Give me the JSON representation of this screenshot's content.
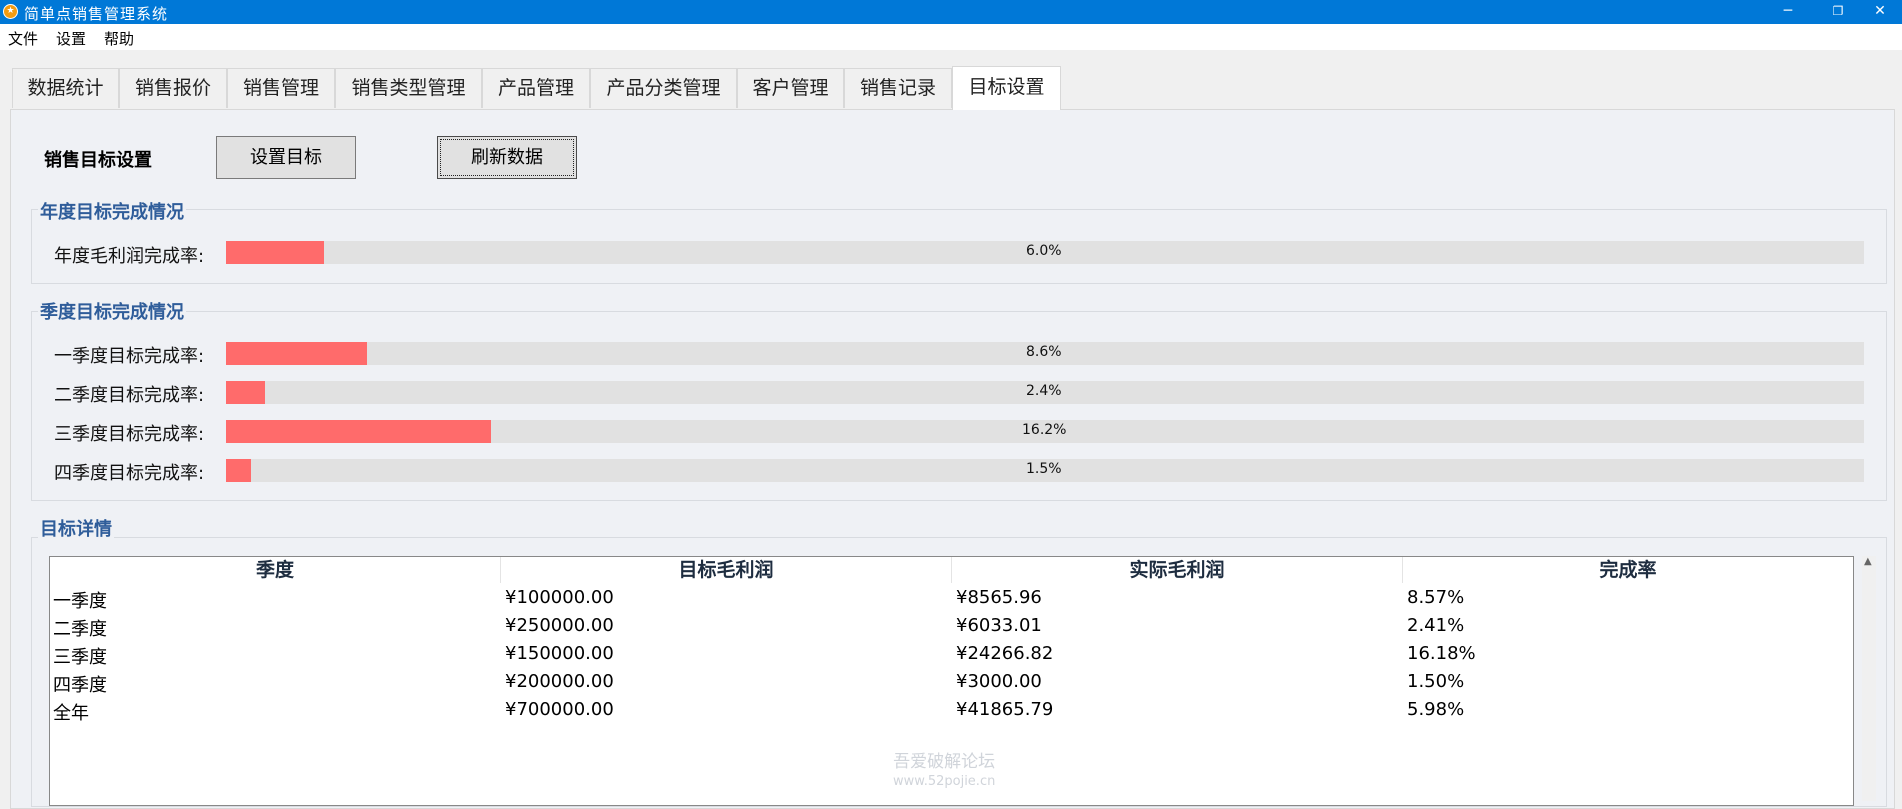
{
  "window": {
    "title": "简单点销售管理系统",
    "controls": {
      "minimize": "─",
      "restore": "❐",
      "close": "✕"
    }
  },
  "menu": [
    "文件",
    "设置",
    "帮助"
  ],
  "tabs": [
    {
      "label": "数据统计"
    },
    {
      "label": "销售报价"
    },
    {
      "label": "销售管理"
    },
    {
      "label": "销售类型管理"
    },
    {
      "label": "产品管理"
    },
    {
      "label": "产品分类管理"
    },
    {
      "label": "客户管理"
    },
    {
      "label": "销售记录"
    },
    {
      "label": "目标设置",
      "active": true
    }
  ],
  "toolbar": {
    "heading": "销售目标设置",
    "set_target_label": "设置目标",
    "refresh_label": "刷新数据"
  },
  "annual": {
    "title": "年度目标完成情况",
    "label": "年度毛利润完成率:",
    "percent": 6.0,
    "text": "6.0%"
  },
  "quarterly": {
    "title": "季度目标完成情况",
    "items": [
      {
        "label": "一季度目标完成率:",
        "percent": 8.6,
        "text": "8.6%"
      },
      {
        "label": "二季度目标完成率:",
        "percent": 2.4,
        "text": "2.4%"
      },
      {
        "label": "三季度目标完成率:",
        "percent": 16.2,
        "text": "16.2%"
      },
      {
        "label": "四季度目标完成率:",
        "percent": 1.5,
        "text": "1.5%"
      }
    ]
  },
  "details": {
    "title": "目标详情",
    "columns": [
      "季度",
      "目标毛利润",
      "实际毛利润",
      "完成率"
    ],
    "rows": [
      [
        "一季度",
        "¥100000.00",
        "¥8565.96",
        "8.57%"
      ],
      [
        "二季度",
        "¥250000.00",
        "¥6033.01",
        "2.41%"
      ],
      [
        "三季度",
        "¥150000.00",
        "¥24266.82",
        "16.18%"
      ],
      [
        "四季度",
        "¥200000.00",
        "¥3000.00",
        "1.50%"
      ],
      [
        "全年",
        "¥700000.00",
        "¥41865.79",
        "5.98%"
      ]
    ]
  },
  "watermark": {
    "line1": "吾爱破解论坛",
    "line2": "www.52pojie.cn"
  },
  "colors": {
    "titlebar": "#0078d7",
    "progress_fill": "#ff6b6b",
    "group_title": "#2f5d9a"
  }
}
